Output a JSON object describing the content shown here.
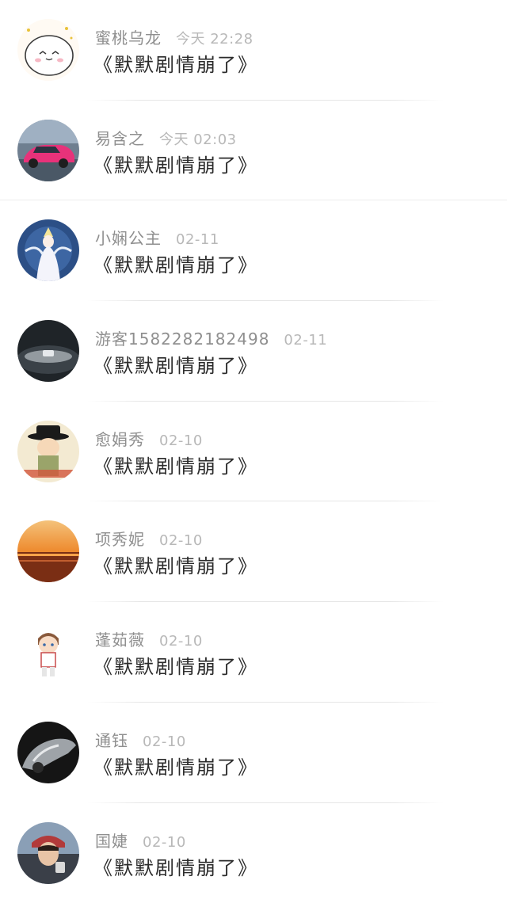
{
  "messages": [
    {
      "name": "蜜桃乌龙",
      "time": "今天 22:28",
      "text": "《默默剧情崩了》",
      "avatar_icon": "cartoon-bun-avatar"
    },
    {
      "name": "易含之",
      "time": "今天 02:03",
      "text": "《默默剧情崩了》",
      "avatar_icon": "pink-car-avatar"
    },
    {
      "name": "小娴公主",
      "time": "02-11",
      "text": "《默默剧情崩了》",
      "avatar_icon": "anime-angel-avatar"
    },
    {
      "name": "游客15822821824​98",
      "time": "02-11",
      "text": "《默默剧情崩了》",
      "avatar_icon": "car-emblem-avatar"
    },
    {
      "name": "愈娟秀",
      "time": "02-10",
      "text": "《默默剧情崩了》",
      "avatar_icon": "cartoon-hat-avatar"
    },
    {
      "name": "项秀妮",
      "time": "02-10",
      "text": "《默默剧情崩了》",
      "avatar_icon": "sunset-sea-avatar"
    },
    {
      "name": "蓬茹薇",
      "time": "02-10",
      "text": "《默默剧情崩了》",
      "avatar_icon": "chibi-boy-avatar"
    },
    {
      "name": "通钰",
      "time": "02-10",
      "text": "《默默剧情崩了》",
      "avatar_icon": "silver-car-avatar"
    },
    {
      "name": "国婕",
      "time": "02-10",
      "text": "《默默剧情崩了》",
      "avatar_icon": "photo-person-avatar"
    }
  ]
}
